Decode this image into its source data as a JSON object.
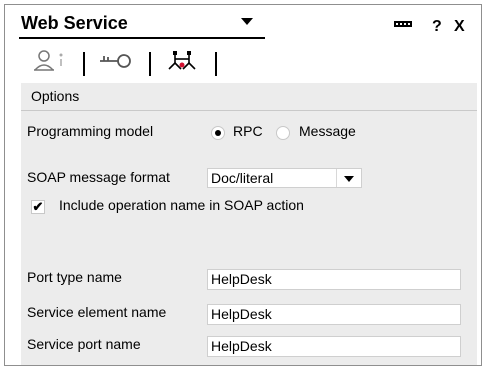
{
  "header": {
    "title": "Web Service",
    "help_label": "?",
    "close_label": "X"
  },
  "tabs": [
    {
      "icon": "user-icon",
      "selected": false
    },
    {
      "icon": "key-icon",
      "selected": false
    },
    {
      "icon": "network-icon",
      "selected": true
    }
  ],
  "options": {
    "section_title": "Options",
    "programming_model": {
      "label": "Programming model",
      "options": [
        "RPC",
        "Message"
      ],
      "selected": "RPC"
    },
    "soap_format": {
      "label": "SOAP message format",
      "value": "Doc/literal"
    },
    "include_op": {
      "label": "Include operation name in SOAP action",
      "checked": true,
      "mark": "✔"
    },
    "port_type": {
      "label": "Port type name",
      "value": "HelpDesk"
    },
    "service_element": {
      "label": "Service element name",
      "value": "HelpDesk"
    },
    "service_port": {
      "label": "Service port name",
      "value": "HelpDesk"
    }
  }
}
